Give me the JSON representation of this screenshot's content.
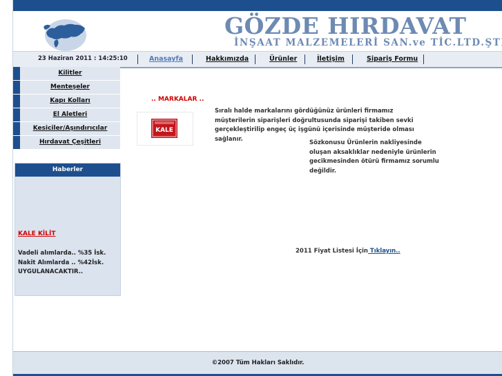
{
  "header": {
    "brand_title": "GÖZDE HIRDAVAT",
    "brand_subtitle": "İNŞAAT MALZEMELERİ SAN.ve TİC.LTD.ŞTİ.",
    "logo_icon": "turkey-map-icon"
  },
  "navbar": {
    "date": "23 Haziran 2011 : 14:25:10",
    "items": [
      {
        "label": "Anasayfa",
        "active": true
      },
      {
        "label": "Hakkımızda",
        "active": false
      },
      {
        "label": "Ürünler",
        "active": false
      },
      {
        "label": "İletişim",
        "active": false
      },
      {
        "label": "Sipariş Formu",
        "active": false
      }
    ]
  },
  "sidebar": {
    "items": [
      {
        "label": "Kilitler"
      },
      {
        "label": "Menteşeler"
      },
      {
        "label": "Kapı Kolları"
      },
      {
        "label": "El Aletleri"
      },
      {
        "label": "Kesiciler/Aşındırıcılar"
      },
      {
        "label": "Hırdavat Çeşitleri"
      }
    ]
  },
  "news": {
    "title": "Haberler",
    "link": "KALE KİLİT",
    "lines": [
      "Vadeli alımlarda.. %35 İsk.",
      "Nakit Alımlarda .. %42İsk.",
      "UYGULANACAKTIR.."
    ]
  },
  "main": {
    "brands_heading": ".. MARKALAR ..",
    "brand_logo_text": "KALE",
    "paragraph1": "Sıralı halde markalarını gördüğünüz ürünleri firmamız müşterilerin siparişleri doğrultusunda siparişi takiben sevki gerçekleştirilip engeç üç işgünü içerisinde müşteride olması sağlanır.",
    "paragraph2": "Sözkonusu Ürünlerin nakliyesinde oluşan aksaklıklar nedeniyle ürünlerin gecikmesinden ötürü firmamız sorumlu değildir.",
    "price_list_text": "2011 Fiyat Listesi İçin",
    "price_list_link": " Tıklayın.."
  },
  "footer": {
    "copyright": "©2007 Tüm Hakları Saklıdır."
  },
  "colors": {
    "accent": "#1d4f8e",
    "brand_text": "#6d8ab3",
    "alert_red": "#d10000",
    "nav_bg": "#e8edf4"
  }
}
